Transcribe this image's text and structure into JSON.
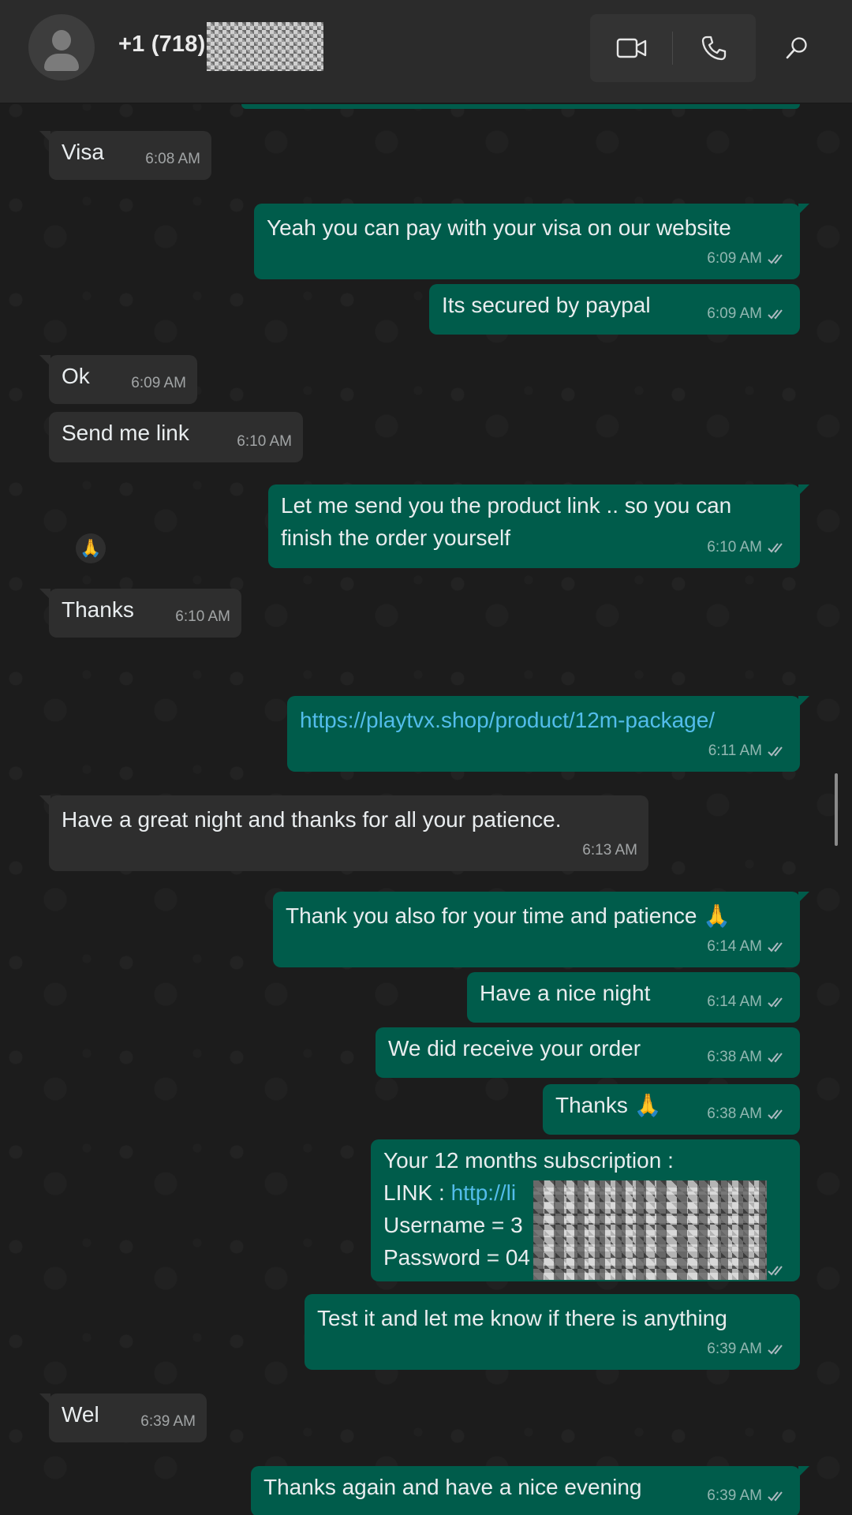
{
  "header": {
    "contact_name": "+1 (718)",
    "video_call_icon": "video-camera-icon",
    "voice_call_icon": "phone-icon",
    "search_icon": "search-icon"
  },
  "colors": {
    "incoming_bubble": "#2e2e2e",
    "outgoing_bubble": "#005c4b",
    "link": "#53bdeb",
    "header": "#2b2b2b"
  },
  "messages": [
    {
      "dir": "in",
      "text": "Visa",
      "time": "6:08 AM"
    },
    {
      "dir": "out",
      "text": "Yeah you can pay with your visa on our website",
      "time": "6:09 AM"
    },
    {
      "dir": "out",
      "text": "Its secured by paypal",
      "time": "6:09 AM"
    },
    {
      "dir": "in",
      "text": "Ok",
      "time": "6:09 AM"
    },
    {
      "dir": "in",
      "text": "Send me link",
      "time": "6:10 AM"
    },
    {
      "dir": "out",
      "text": "Let me send you the product link .. so you can finish the order yourself",
      "time": "6:10 AM"
    },
    {
      "dir": "in",
      "text": "Thanks",
      "time": "6:10 AM",
      "reaction": "🙏"
    },
    {
      "dir": "out",
      "text": "https://playtvx.shop/product/12m-package/",
      "time": "6:11 AM",
      "is_link": true
    },
    {
      "dir": "in",
      "text": "Have a great night  and thanks  for all your patience.",
      "time": "6:13 AM"
    },
    {
      "dir": "out",
      "text": "Thank you also for your time and patience 🙏",
      "time": "6:14 AM"
    },
    {
      "dir": "out",
      "text": "Have a nice night",
      "time": "6:14 AM"
    },
    {
      "dir": "out",
      "text": "We did receive your order",
      "time": "6:38 AM"
    },
    {
      "dir": "out",
      "text": "Thanks 🙏",
      "time": "6:38 AM"
    },
    {
      "dir": "out",
      "line1": "Your 12 months subscription :",
      "line2_label": "LINK : ",
      "line2_link": "http://li",
      "line3": "Username = 3",
      "line4": "Password = 04",
      "time": ""
    },
    {
      "dir": "out",
      "text": "Test it and let me know if there is anything",
      "time": "6:39 AM"
    },
    {
      "dir": "in",
      "text": "Wel",
      "time": "6:39 AM"
    },
    {
      "dir": "out",
      "text": "Thanks again and have a nice evening",
      "time": "6:39 AM"
    }
  ]
}
